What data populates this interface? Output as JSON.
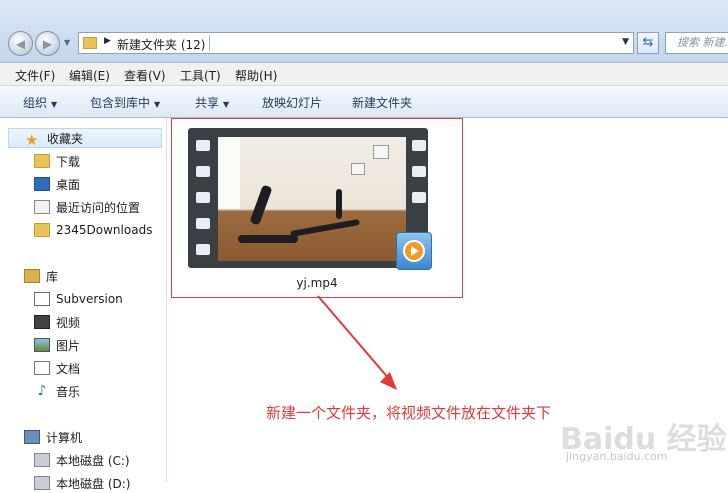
{
  "titlebar": {
    "address_path": "新建文件夹 (12)",
    "search_placeholder": "搜索 新建..."
  },
  "menu": [
    "文件(F)",
    "编辑(E)",
    "查看(V)",
    "工具(T)",
    "帮助(H)"
  ],
  "toolbar": [
    "组织",
    "包含到库中",
    "共享",
    "放映幻灯片",
    "新建文件夹"
  ],
  "sidebar": {
    "favorites_title": "收藏夹",
    "favorites": [
      "下载",
      "桌面",
      "最近访问的位置",
      "2345Downloads"
    ],
    "library_title": "库",
    "libraries": [
      "Subversion",
      "视频",
      "图片",
      "文档",
      "音乐"
    ],
    "computer_title": "计算机",
    "drives": [
      "本地磁盘 (C:)",
      "本地磁盘 (D:)"
    ]
  },
  "file": {
    "name": "yj.mp4"
  },
  "annotation": {
    "caption": "新建一个文件夹，将视频文件放在文件夹下",
    "color": "#e23a3a"
  },
  "watermark": {
    "brand": "Baidu 经验",
    "url": "jingyan.baidu.com"
  }
}
